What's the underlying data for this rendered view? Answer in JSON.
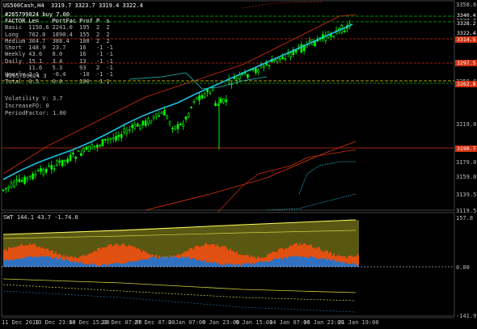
{
  "header": {
    "symbol_line": "US500Cash,H4  3319.7 3323.7 3319.4 3322.4",
    "indicator_title": "#265799824 buy 7.00",
    "overlay_text": "#265799824 3",
    "swt_label": "SWT 144.1 43.7 -1.74.0"
  },
  "stats": {
    "columns": [
      "FACTOR",
      "Len",
      "PortFac",
      "Prof",
      "P",
      "s"
    ],
    "rows": [
      [
        "Basic",
        "1150.6",
        "2241.0",
        "195",
        "2",
        "2"
      ],
      [
        "Long",
        "702.0",
        "1890.4",
        "155",
        "2",
        "2"
      ],
      [
        "Medium",
        "364.7",
        "388.4",
        "108",
        "2",
        "2"
      ],
      [
        "Short",
        "148.9",
        "23.7",
        "16",
        "-1",
        "-1"
      ],
      [
        "Weekly",
        "43.6",
        "8.0",
        "16",
        "-1",
        "-1"
      ],
      [
        "Daily",
        "15.1",
        "3.4",
        "13",
        "-1",
        "-1"
      ],
      [
        "",
        "11.6",
        "5.3",
        "93",
        "2",
        "-1"
      ],
      [
        "Hourly",
        "2.1",
        "-0.4",
        "-10",
        "-1",
        "-1"
      ],
      [
        "Total",
        "0.5",
        "0.0",
        "100",
        "-1",
        "1"
      ]
    ],
    "volatility": "Volatility V: 3.7",
    "increase": "IncreaseFO: 0",
    "period": "PeriodFactor: 1.00"
  },
  "price_axis": {
    "ticks": [
      "3358.6",
      "3338.6",
      "3298.6",
      "3258.6",
      "3219.0",
      "3179.0",
      "3159.0",
      "3139.5",
      "3119.5"
    ],
    "tags": [
      {
        "text": "3340.4",
        "bg": "#000000",
        "fg": "#ffffff"
      },
      {
        "text": "3328.2",
        "bg": "#000000",
        "fg": "#ffffff"
      },
      {
        "text": "3322.4",
        "bg": "#000000",
        "fg": "#ffffff"
      },
      {
        "text": "3314.5",
        "bg": "#d03010",
        "fg": "#ffffff"
      },
      {
        "text": "3297.5",
        "bg": "#d03010",
        "fg": "#ffffff"
      },
      {
        "text": "3262.8",
        "bg": "#d03010",
        "fg": "#ffffff"
      },
      {
        "text": "3190.7",
        "bg": "#d03010",
        "fg": "#ffffff"
      }
    ]
  },
  "swt_axis": {
    "ticks": [
      "157.8",
      "0.00",
      "-141.9"
    ]
  },
  "time_axis": {
    "labels": [
      "11 Dec 2019",
      "13 Dec 23:00",
      "18 Dec 15:00",
      "23 Dec 07:00",
      "27 Dec 07:00",
      "2 Jan 07:00",
      "6 Jan 23:00",
      "9 Jan 15:00",
      "14 Jan 07:00",
      "16 Jan 23:00",
      "21 Jan 19:00"
    ]
  },
  "colors": {
    "background": "#000000",
    "candle": "#00ff00",
    "ma": "#20c0e0",
    "level_red": "#d03010",
    "level_green": "#00c000",
    "level_yellow": "#e0e000",
    "hist_blue": "#3070c0",
    "hist_orange": "#e05010"
  }
}
